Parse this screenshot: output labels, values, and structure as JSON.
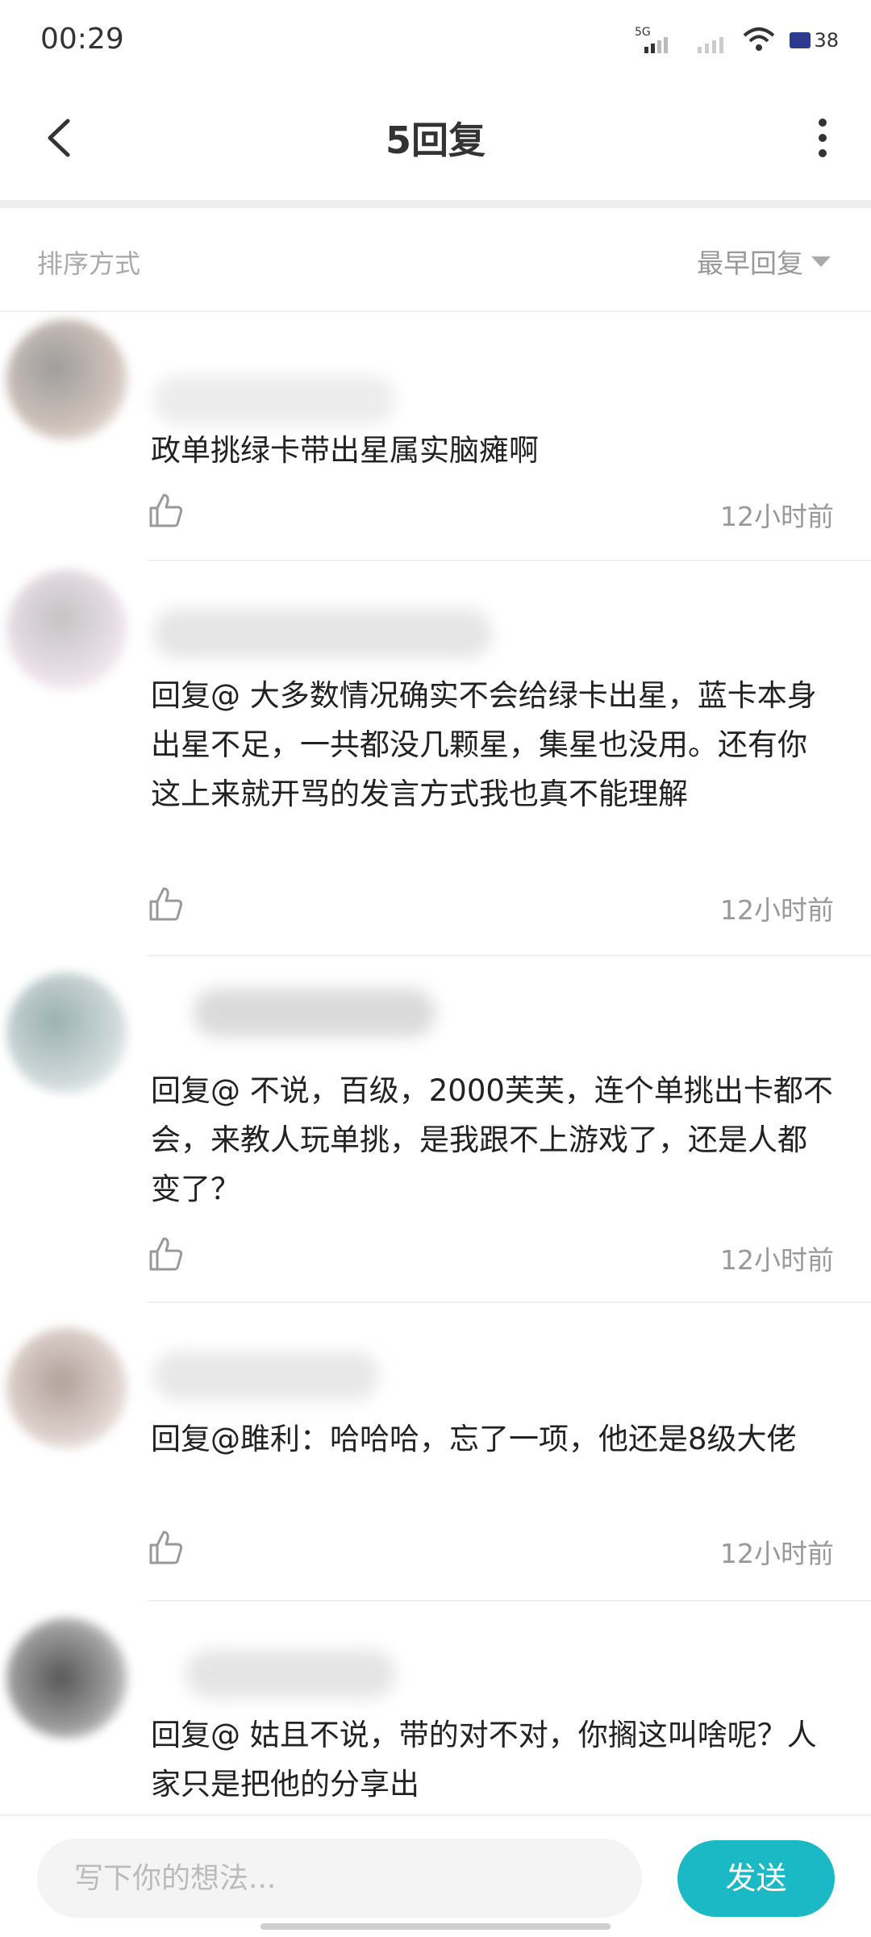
{
  "status_bar": {
    "time": "00:29",
    "network": "5G",
    "battery": "38"
  },
  "header": {
    "title": "5回复"
  },
  "sort": {
    "label": "排序方式",
    "selected": "最早回复"
  },
  "comments": [
    {
      "text": "政单挑绿卡带出星属实脑瘫啊",
      "time": "12小时前"
    },
    {
      "text": "回复@                    大多数情况确实不会给绿卡出星，蓝卡本身出星不足，一共都没几颗星，集星也没用。还有你这上来就开骂的发言方式我也真不能理解",
      "time": "12小时前"
    },
    {
      "text": "回复@           不说，百级，2000芙芙，连个单挑出卡都不会，来教人玩单挑，是我跟不上游戏了，还是人都变了？",
      "time": "12小时前"
    },
    {
      "text": "回复@雎利：哈哈哈，忘了一项，他还是8级大佬",
      "time": "12小时前"
    },
    {
      "text": "回复@            姑且不说，带的对不对，你搁这叫啥呢？人家只是把他的分享出",
      "time": ""
    }
  ],
  "input": {
    "placeholder": "写下你的想法..."
  },
  "send": {
    "label": "发送"
  },
  "colors": {
    "accent": "#1bb8c5"
  }
}
